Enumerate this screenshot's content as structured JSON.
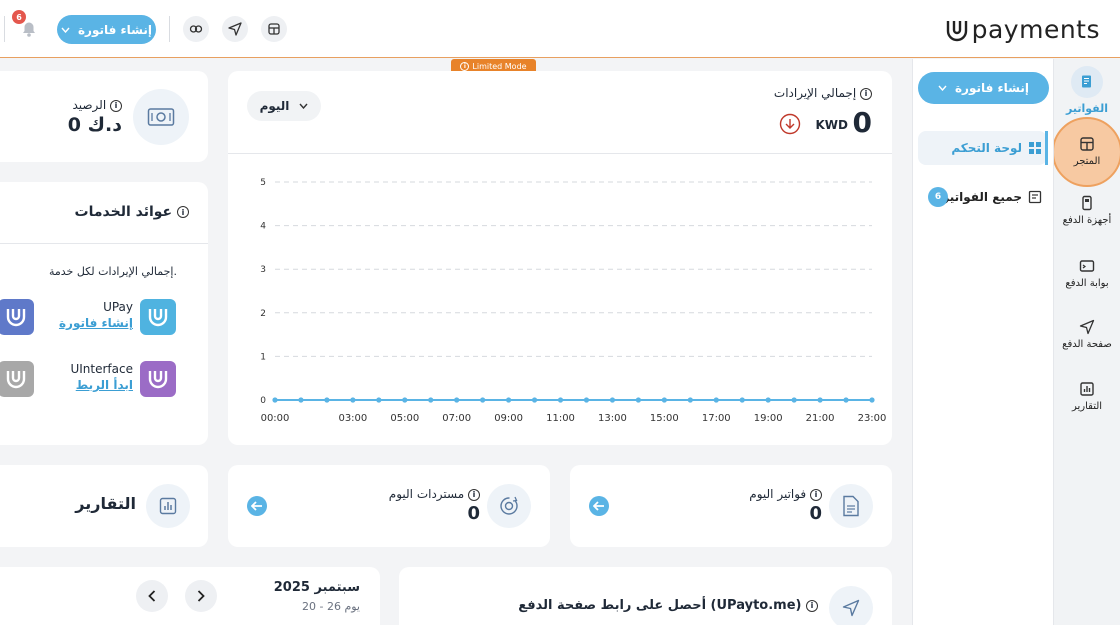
{
  "topbar": {
    "logo_text": "payments",
    "create_invoice_label": "إنشاء فاتورة",
    "notification_count": "6",
    "limited_mode_label": "Limited Mode"
  },
  "rail": {
    "items": [
      {
        "label": "الفواتير",
        "icon": "invoice-icon",
        "active": true
      },
      {
        "label": "المتجر",
        "icon": "store-icon"
      },
      {
        "label": "أجهزة الدفع",
        "icon": "pos-device-icon"
      },
      {
        "label": "بوابة الدفع",
        "icon": "payment-gateway-icon"
      },
      {
        "label": "صفحة الدفع",
        "icon": "send-icon"
      },
      {
        "label": "التقارير",
        "icon": "reports-icon"
      }
    ]
  },
  "panel": {
    "create_invoice_label": "إنشاء فاتورة",
    "dashboard_label": "لوحة التحكم",
    "all_invoices_label": "جميع الفواتير",
    "all_invoices_count": "6"
  },
  "revenue": {
    "title": "إجمالي الإيرادات",
    "amount": "0",
    "currency": "KWD",
    "period_selected": "اليوم"
  },
  "chart_data": {
    "type": "line",
    "x": [
      "00:00",
      "01:00",
      "02:00",
      "03:00",
      "04:00",
      "05:00",
      "06:00",
      "07:00",
      "08:00",
      "09:00",
      "10:00",
      "11:00",
      "12:00",
      "13:00",
      "14:00",
      "15:00",
      "16:00",
      "17:00",
      "18:00",
      "19:00",
      "20:00",
      "21:00",
      "22:00",
      "23:00"
    ],
    "x_tick_labels": [
      "00:00",
      "03:00",
      "05:00",
      "07:00",
      "09:00",
      "11:00",
      "13:00",
      "15:00",
      "17:00",
      "19:00",
      "21:00",
      "23:00"
    ],
    "series": [
      {
        "values": [
          0,
          0,
          0,
          0,
          0,
          0,
          0,
          0,
          0,
          0,
          0,
          0,
          0,
          0,
          0,
          0,
          0,
          0,
          0,
          0,
          0,
          0,
          0,
          0
        ]
      }
    ],
    "y_ticks": [
      "0",
      "1",
      "2",
      "3",
      "4",
      "5"
    ],
    "ylim": [
      0,
      5
    ],
    "grid": true,
    "color": "#5ab4e5"
  },
  "balance": {
    "label": "الرصيد",
    "value": "0 د.ك"
  },
  "services": {
    "title": "عوائد الخدمات",
    "subtitle": "إجمالي الإيرادات لكل خدمة.",
    "items": [
      {
        "name": "UPay",
        "action": "إنشاء فاتورة",
        "color": "#4fb3e0"
      },
      {
        "name": "UInterface",
        "action": "ابدأ الربط",
        "color": "#9b6cc6"
      }
    ]
  },
  "today_invoices": {
    "label": "فواتير اليوم",
    "value": "0"
  },
  "today_refunds": {
    "label": "مستردات اليوم",
    "value": "0"
  },
  "reports": {
    "title": "التقارير"
  },
  "calendar": {
    "month": "سبتمبر 2025",
    "range": "20 - 26 يوم"
  },
  "payto": {
    "title": "أحصل على رابط صفحة الدفع (UPayto.me)"
  }
}
